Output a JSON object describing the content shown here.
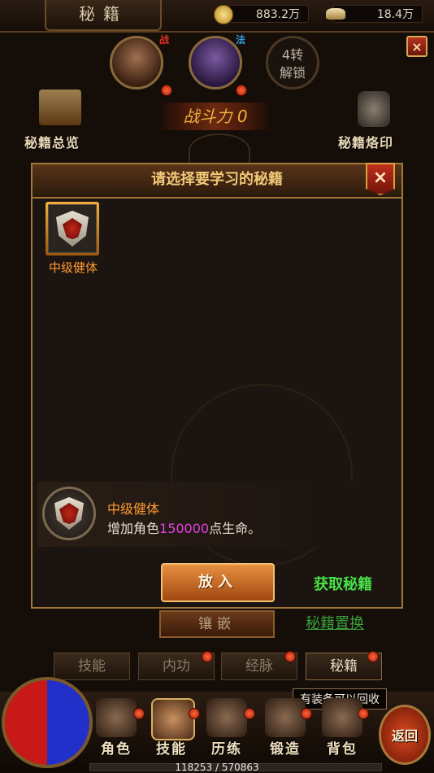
{
  "header": {
    "title": "秘籍",
    "gold": "883.2万",
    "ingot": "18.4万",
    "close": "×"
  },
  "portraits": [
    {
      "tag": "战"
    },
    {
      "tag": "法"
    },
    {
      "label": "4转\n解锁",
      "line1": "4转",
      "line2": "解锁"
    }
  ],
  "panel": {
    "overview_label": "秘籍总览",
    "seal_label": "秘籍烙印",
    "power_label": "战斗力",
    "power_value": "0"
  },
  "dialog": {
    "title": "请选择要学习的秘籍",
    "close": "×",
    "slots": [
      {
        "name": "中级健体"
      }
    ],
    "selected": {
      "name": "中级健体",
      "desc_prefix": "增加角色",
      "desc_value": "150000",
      "desc_suffix": "点生命。"
    },
    "put_button": "放入",
    "get_link": "获取秘籍"
  },
  "behind": {
    "inlay_button": "镶嵌",
    "swap_link": "秘籍置换"
  },
  "subtabs": [
    {
      "label": "技能",
      "active": false
    },
    {
      "label": "内功",
      "active": false
    },
    {
      "label": "经脉",
      "active": false
    },
    {
      "label": "秘籍",
      "active": true
    }
  ],
  "nav": {
    "items": [
      {
        "label": "角色"
      },
      {
        "label": "技能"
      },
      {
        "label": "历练"
      },
      {
        "label": "锻造"
      },
      {
        "label": "背包"
      }
    ],
    "return_label": "返回",
    "tooltip": "有装备可以回收",
    "exp": "118253 / 570863"
  },
  "colors": {
    "accent": "#ff9a30",
    "highlight": "#e040e0",
    "link": "#48e048",
    "frame": "#a07838"
  }
}
